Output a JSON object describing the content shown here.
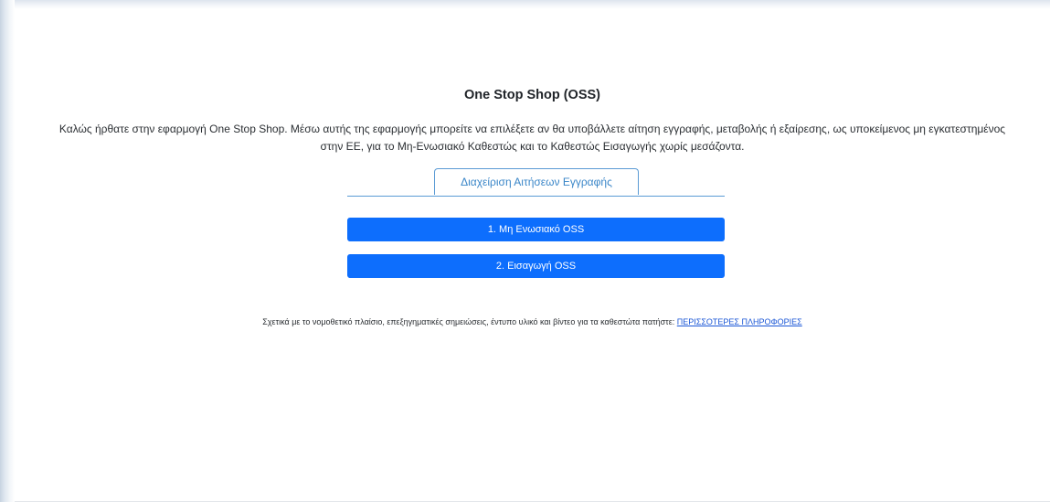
{
  "page": {
    "title": "One Stop Shop (OSS)",
    "intro": "Καλώς ήρθατε στην εφαρμογή One Stop Shop. Μέσω αυτής της εφαρμογής μπορείτε να επιλέξετε αν θα υποβάλλετε αίτηση εγγραφής, μεταβολής ή εξαίρεσης, ως υποκείμενος μη εγκατεστημένος στην ΕΕ, για το Μη-Ενωσιακό Καθεστώς και το Καθεστώς Εισαγωγής χωρίς μεσάζοντα."
  },
  "tabs": {
    "active_label": "Διαχείριση Αιτήσεων Εγγραφής"
  },
  "actions": {
    "non_union_label": "1. Μη Ενωσιακό OSS",
    "import_label": "2. Εισαγωγή OSS"
  },
  "footer": {
    "info_text": "Σχετικά με το νομοθετικό πλαίσιο, επεξηγηματικές σημειώσεις, έντυπο υλικό και βίντεο για τα καθεστώτα πατήστε: ",
    "more_info_link": "ΠΕΡΙΣΣΟΤΕΡΕΣ ΠΛΗΡΟΦΟΡΙΕΣ"
  },
  "colors": {
    "primary_button": "#0d6efd",
    "tab_accent": "#5b9bd5",
    "link": "#1a56d6"
  }
}
